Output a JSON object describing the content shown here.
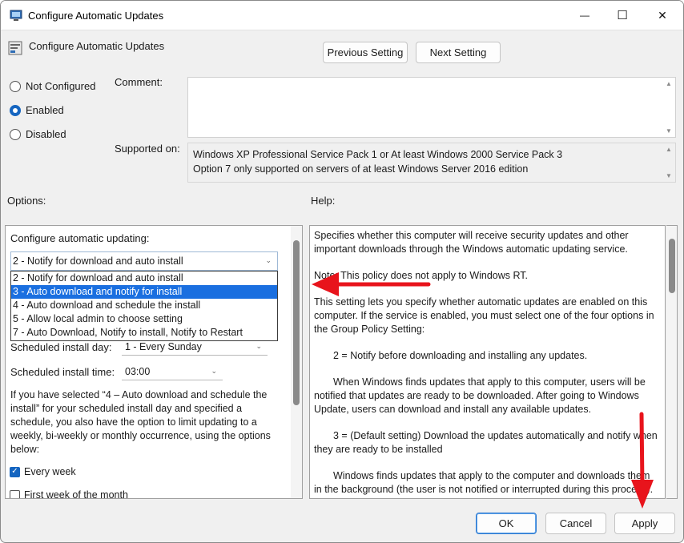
{
  "window": {
    "title": "Configure Automatic Updates",
    "minimize_glyph": "—",
    "maximize_glyph": "☐",
    "close_glyph": "✕"
  },
  "header": {
    "title": "Configure Automatic Updates",
    "prev_label": "Previous Setting",
    "next_label": "Next Setting"
  },
  "state": {
    "options": [
      "Not Configured",
      "Enabled",
      "Disabled"
    ],
    "selected": "Enabled"
  },
  "comment": {
    "label": "Comment:",
    "value": ""
  },
  "supported": {
    "label": "Supported on:",
    "lines": [
      "Windows XP Professional Service Pack 1 or At least Windows 2000 Service Pack 3",
      "Option 7 only supported on servers of at least Windows Server 2016 edition"
    ]
  },
  "options_section": {
    "label": "Options:",
    "configure_label": "Configure automatic updating:",
    "selected_value": "2 - Notify for download and auto install",
    "dropdown_items": [
      "2 - Notify for download and auto install",
      "3 - Auto download and notify for install",
      "4 - Auto download and schedule the install",
      "5 - Allow local admin to choose setting",
      "7 - Auto Download, Notify to install, Notify to Restart"
    ],
    "highlighted_index": 1,
    "install_day_label": "Scheduled install day:",
    "install_day_value": "1 - Every Sunday",
    "install_time_label": "Scheduled install time:",
    "install_time_value": "03:00",
    "paragraph": "If you have selected “4 – Auto download and schedule the install” for your scheduled install day and specified a schedule, you also have the option to limit updating to a weekly, bi-weekly or monthly occurrence, using the options below:",
    "checkboxes": [
      {
        "label": "Every week",
        "checked": true
      },
      {
        "label": "First week of the month",
        "checked": false
      }
    ]
  },
  "help_section": {
    "label": "Help:",
    "paragraphs": [
      "Specifies whether this computer will receive security updates and other important downloads through the Windows automatic updating service.",
      "Note: This policy does not apply to Windows RT.",
      "This setting lets you specify whether automatic updates are enabled on this computer. If the service is enabled, you must select one of the four options in the Group Policy Setting:",
      "2 = Notify before downloading and installing any updates.",
      "When Windows finds updates that apply to this computer, users will be notified that updates are ready to be downloaded. After going to Windows Update, users can download and install any available updates.",
      "3 = (Default setting) Download the updates automatically and notify when they are ready to be installed",
      "Windows finds updates that apply to the computer and downloads them in the background (the user is not notified or interrupted during this process)."
    ]
  },
  "footer": {
    "ok_label": "OK",
    "cancel_label": "Cancel",
    "apply_label": "Apply"
  },
  "colors": {
    "accent": "#1565c0",
    "highlight": "#1a6fe0",
    "annotation": "#e8141c"
  }
}
